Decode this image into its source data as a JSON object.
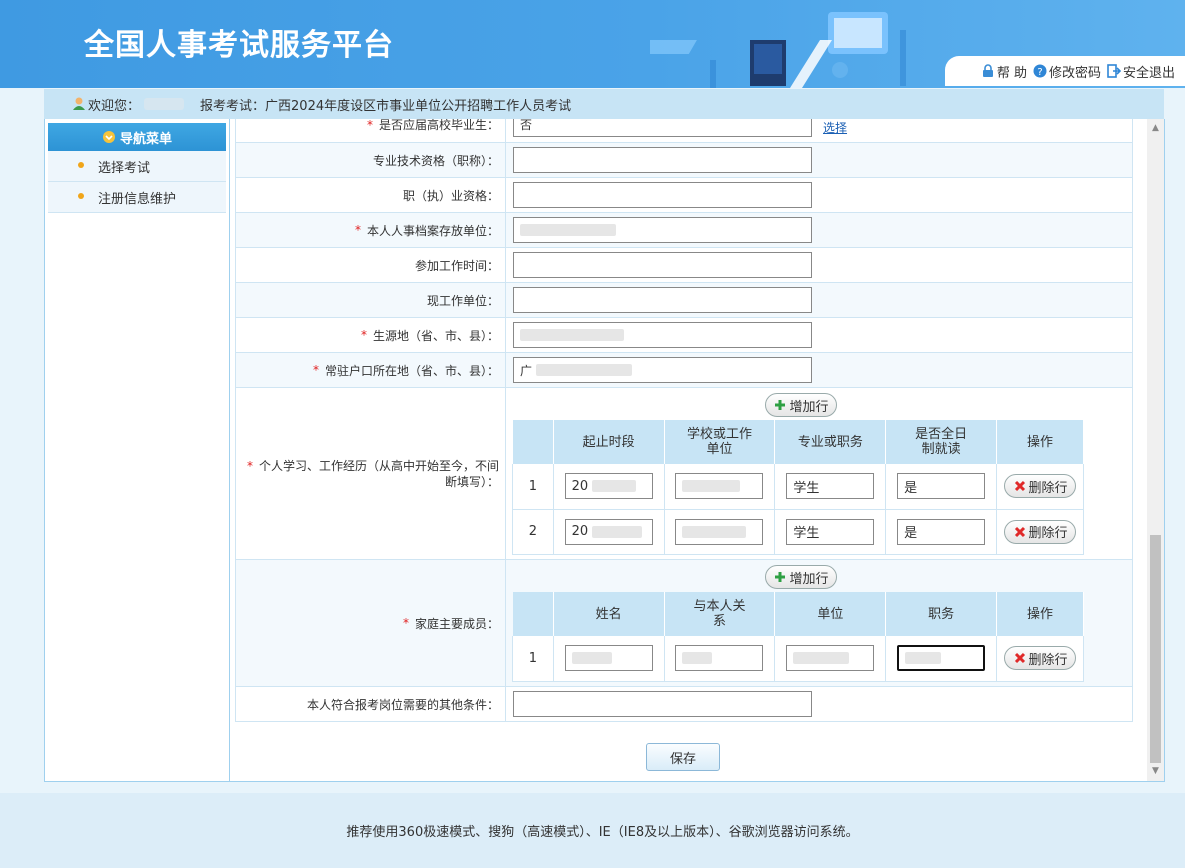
{
  "header": {
    "title": "全国人事考试服务平台",
    "links": {
      "help": "帮 助",
      "change_password": "修改密码",
      "logout": "安全退出"
    }
  },
  "welcome": {
    "greeting": "欢迎您：",
    "exam_label": "报考考试：",
    "exam_name": "广西2024年度设区市事业单位公开招聘工作人员考试"
  },
  "sidebar": {
    "header": "导航菜单",
    "items": [
      {
        "label": "选择考试"
      },
      {
        "label": "注册信息维护"
      }
    ]
  },
  "form": {
    "fields": [
      {
        "label": "是否应届高校毕业生：",
        "required": true,
        "value": "否",
        "link": "选择"
      },
      {
        "label": "专业技术资格（职称）：",
        "required": false,
        "value": ""
      },
      {
        "label": "职（执）业资格：",
        "required": false,
        "value": ""
      },
      {
        "label": "本人人事档案存放单位：",
        "required": true,
        "value": ""
      },
      {
        "label": "参加工作时间：",
        "required": false,
        "value": ""
      },
      {
        "label": "现工作单位：",
        "required": false,
        "value": ""
      },
      {
        "label": "生源地（省、市、县）：",
        "required": true,
        "value": ""
      },
      {
        "label": "常驻户口所在地（省、市、县）：",
        "required": true,
        "value": "广"
      }
    ],
    "experience": {
      "label": "个人学习、工作经历（从高中开始至今，不间断填写）：",
      "add_label": "增加行",
      "headers": [
        "",
        "起止时段",
        "学校或工作单位",
        "专业或职务",
        "是否全日制就读",
        "操作"
      ],
      "rows": [
        {
          "index": "1",
          "period": "20",
          "school": "",
          "major": "学生",
          "fulltime": "是"
        },
        {
          "index": "2",
          "period": "20",
          "school": "",
          "major": "学生",
          "fulltime": "是"
        }
      ],
      "delete_label": "删除行"
    },
    "family": {
      "label": "家庭主要成员：",
      "add_label": "增加行",
      "headers": [
        "",
        "姓名",
        "与本人关系",
        "单位",
        "职务",
        "操作"
      ],
      "rows": [
        {
          "index": "1",
          "name": "",
          "relation": "",
          "unit": "",
          "position": ""
        }
      ],
      "delete_label": "删除行"
    },
    "other": {
      "label": "本人符合报考岗位需要的其他条件：",
      "value": ""
    },
    "save_label": "保存"
  },
  "footer": {
    "text": "推荐使用360极速模式、搜狗（高速模式）、IE（IE8及以上版本）、谷歌浏览器访问系统。"
  }
}
